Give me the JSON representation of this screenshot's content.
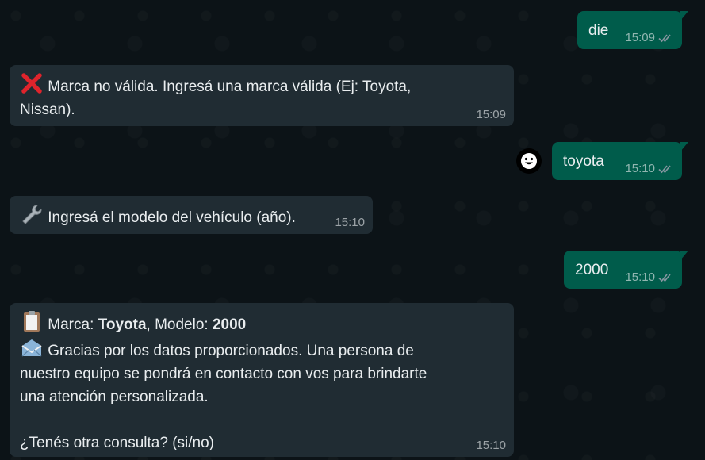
{
  "messages": [
    {
      "id": "m1",
      "dir": "out",
      "text": "die",
      "time": "15:09"
    },
    {
      "id": "m2",
      "dir": "in",
      "icon": "cross-mark-icon",
      "line1": "Marca no válida. Ingresá una marca válida (Ej: Toyota,",
      "line2": "Nissan).",
      "time": "15:09"
    },
    {
      "id": "m3",
      "dir": "out",
      "text": "toyota",
      "time": "15:10"
    },
    {
      "id": "m4",
      "dir": "in",
      "icon": "wrench-icon",
      "text": "Ingresá el modelo del vehículo (año).",
      "time": "15:10"
    },
    {
      "id": "m5",
      "dir": "out",
      "text": "2000",
      "time": "15:10"
    },
    {
      "id": "m6",
      "dir": "in",
      "icon1": "clipboard-icon",
      "marca_label": "Marca: ",
      "marca_value": "Toyota",
      "modelo_label": ", Modelo: ",
      "modelo_value": "2000",
      "icon2": "envelope-icon",
      "line2": "Gracias por los datos proporcionados. Una persona de",
      "line3": "nuestro equipo se pondrá en contacto con vos para brindarte",
      "line4": "una atención personalizada.",
      "line5": "¿Tenés otra consulta? (si/no)",
      "time": "15:10"
    }
  ],
  "colors": {
    "outgoing_bubble": "#005c4b",
    "incoming_bubble": "#202c33",
    "background": "#0b141a",
    "tick_read": "#8696a0"
  }
}
